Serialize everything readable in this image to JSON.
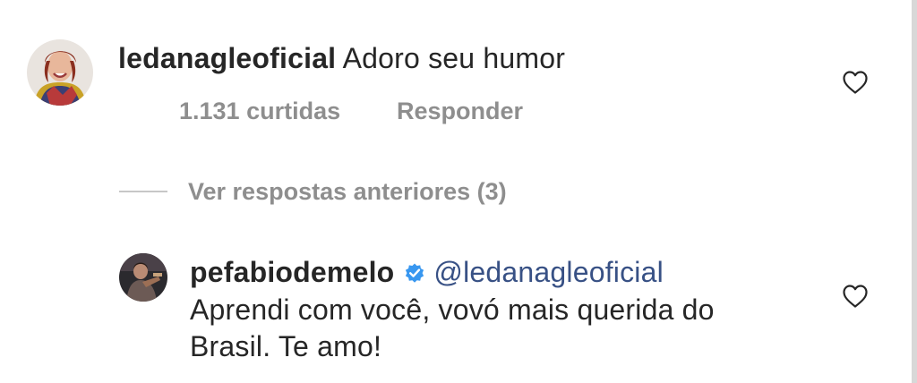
{
  "comments": [
    {
      "username": "ledanagleoficial",
      "text": "Adoro seu humor",
      "likes_label": "1.131 curtidas",
      "reply_label": "Responder",
      "avatar_icon": "avatar-photo",
      "like_icon": "heart-outline-icon"
    }
  ],
  "view_replies_label": "Ver respostas anteriores (3)",
  "reply": {
    "username": "pefabiodemelo",
    "verified": true,
    "verified_icon": "verified-badge-icon",
    "mention": "@ledanagleoficial",
    "text_line1": "Aprendi com você, vovó mais querida do",
    "text_line2": "Brasil. Te amo!",
    "avatar_icon": "avatar-photo",
    "like_icon": "heart-outline-icon"
  },
  "colors": {
    "text": "#262626",
    "secondary": "#8e8e8e",
    "mention": "#385185",
    "verified": "#3897f0"
  }
}
